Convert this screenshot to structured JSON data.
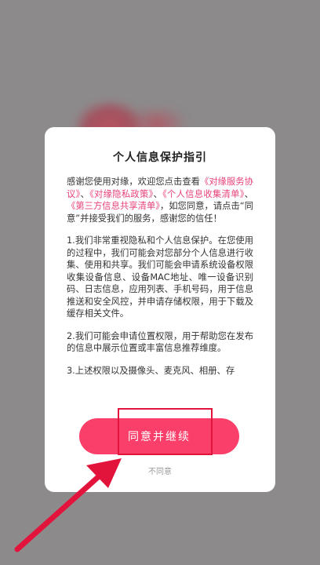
{
  "dialog": {
    "title": "个人信息保护指引",
    "intro": {
      "part1": "感谢您使用对缘，欢迎您点击查看",
      "link1": "《对缘服务协议》",
      "sep1": "、",
      "link2": "《对缘隐私政策》",
      "sep2": "、",
      "link3": "《个人信息收集清单》",
      "sep3": "、",
      "link4": "《第三方信息共享清单》",
      "part2": "，如您同意，请点击“同意”并接受我们的服务，感谢您的信任！"
    },
    "item1": "1.我们非常重视隐私和个人信息保护。在您使用的过程中，我们可能会对您部分个人信息进行收集、使用和共享。我们可能会申请系统设备权限收集设备信息、设备MAC地址、唯一设备识别码、日志信息，应用列表、手机号码，用于信息推送和安全风控，并申请存储权限，用于下载及缓存相关文件。",
    "item2": "2.我们可能会申请位置权限，用于帮助您在发布的信息中展示位置或丰富信息推荐维度。",
    "item3": "3.上述权限以及摄像头、麦克风、相册、存",
    "agree_label": "同意并继续",
    "decline_label": "不同意"
  },
  "colors": {
    "accent": "#fb3f6b",
    "link": "#e8417a",
    "annotation": "#e3143c"
  }
}
